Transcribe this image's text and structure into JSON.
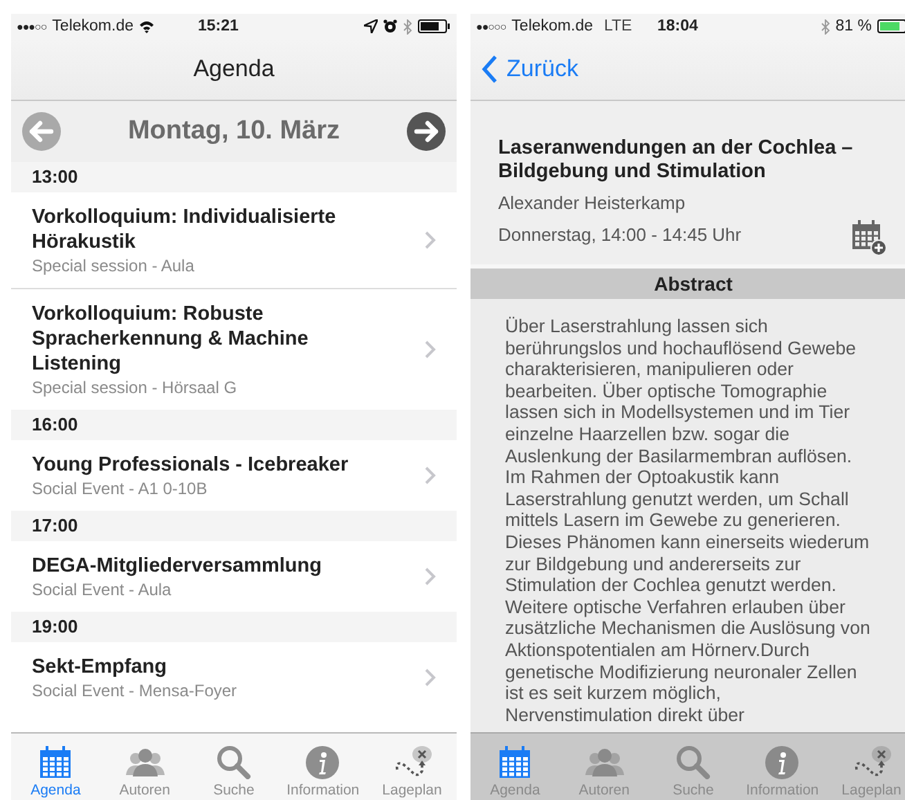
{
  "screens": [
    {
      "kind": "agenda",
      "status_bar": {
        "signal": "●●●○○",
        "carrier": "Telekom.de",
        "left_icons": [
          {
            "kind": "wifi"
          }
        ],
        "time": "15:21",
        "right_icons": [
          {
            "kind": "location"
          },
          {
            "kind": "alarm"
          },
          {
            "kind": "bluetooth"
          }
        ],
        "charging": false
      },
      "nav_bar": {
        "title": "Agenda"
      },
      "date_bar": {
        "date": "Montag, 10. März",
        "prev_disabled": true,
        "next_disabled": false
      },
      "sections": [
        {
          "time": "13:00",
          "items": [
            {
              "title": "Vorkolloquium: Individualisierte Hörakustik",
              "subtitle": "Special session - Aula"
            },
            {
              "title": "Vorkolloquium: Robuste Spracherkennung & Machine Listening",
              "subtitle": "Special session - Hörsaal G"
            }
          ]
        },
        {
          "time": "16:00",
          "items": [
            {
              "title": "Young Professionals - Icebreaker",
              "subtitle": "Social Event - A1 0-10B"
            }
          ]
        },
        {
          "time": "17:00",
          "items": [
            {
              "title": "DEGA-Mitgliederversammlung",
              "subtitle": "Social Event - Aula"
            }
          ]
        },
        {
          "time": "19:00",
          "items": [
            {
              "title": "Sekt-Empfang",
              "subtitle": "Social Event - Mensa-Foyer"
            }
          ]
        }
      ],
      "tab_bar": {
        "dimmed": false,
        "tabs": [
          {
            "kind": "calendar",
            "label": "Agenda",
            "selected": true
          },
          {
            "kind": "people",
            "label": "Autoren",
            "selected": false
          },
          {
            "kind": "search",
            "label": "Suche",
            "selected": false
          },
          {
            "kind": "info",
            "label": "Information",
            "selected": false
          },
          {
            "kind": "map",
            "label": "Lageplan",
            "selected": false
          }
        ]
      }
    },
    {
      "kind": "detail",
      "status_bar": {
        "signal": "●●○○○",
        "carrier": "Telekom.de",
        "network": "LTE",
        "time": "18:04",
        "right_icons": [
          {
            "kind": "bluetooth"
          }
        ],
        "battery_text": "81 %",
        "charging": true
      },
      "nav_bar": {
        "back": "Zurück"
      },
      "talk": {
        "title": "Laseranwendungen an der Cochlea – Bildgebung und Stimulation",
        "author": "Alexander Heisterkamp",
        "time": "Donnerstag, 14:00 - 14:45 Uhr"
      },
      "abstract": {
        "heading": "Abstract",
        "text": "Über Laserstrahlung lassen sich berührungslos und hochauflösend Gewebe charakterisieren, manipulieren oder bearbeiten. Über optische Tomographie lassen sich in Modellsystemen und im Tier einzelne Haarzellen bzw. sogar die Auslenkung der Basilarmembran auflösen. Im Rahmen der Optoakustik kann Laserstrahlung genutzt werden, um Schall mittels Lasern im Gewebe zu generieren. Dieses Phänomen kann einerseits wiederum zur Bildgebung und andererseits zur Stimulation der Cochlea genutzt werden. Weitere optische Verfahren erlauben über zusätzliche Mechanismen die Auslösung von Aktionspotentialen am Hörnerv.Durch genetische Modifizierung neuronaler Zellen ist es seit kurzem möglich, Nervenstimulation direkt über"
      },
      "tab_bar": {
        "dimmed": true,
        "tabs": [
          {
            "kind": "calendar",
            "label": "Agenda",
            "selected": true
          },
          {
            "kind": "people",
            "label": "Autoren",
            "selected": false
          },
          {
            "kind": "search",
            "label": "Suche",
            "selected": false
          },
          {
            "kind": "info",
            "label": "Information",
            "selected": false
          },
          {
            "kind": "map",
            "label": "Lageplan",
            "selected": false
          }
        ]
      }
    }
  ]
}
